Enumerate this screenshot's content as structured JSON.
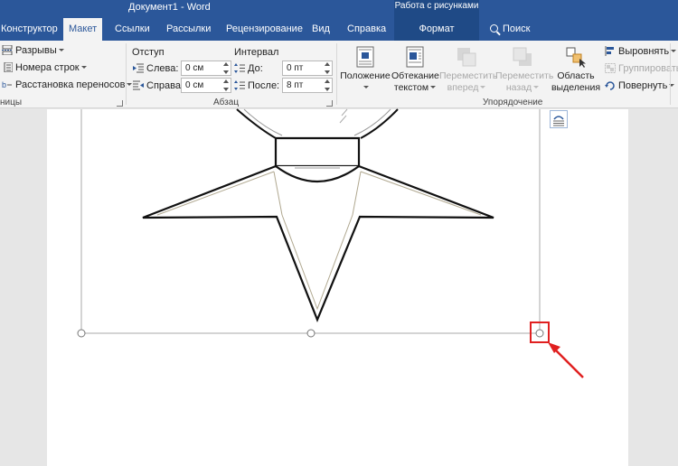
{
  "window": {
    "title": "Документ1 - Word",
    "context_group": "Работа с рисунками"
  },
  "tabs": [
    {
      "label": "Конструктор"
    },
    {
      "label": "Макет",
      "active": true
    },
    {
      "label": "Ссылки"
    },
    {
      "label": "Рассылки"
    },
    {
      "label": "Рецензирование"
    },
    {
      "label": "Вид"
    },
    {
      "label": "Справка"
    },
    {
      "label": "Формат",
      "contextual": true
    },
    {
      "label": "Поиск"
    }
  ],
  "ribbon": {
    "page_setup": {
      "breaks": "Разрывы",
      "line_numbers": "Номера строк",
      "hyphenation": "Расстановка переносов",
      "group_label": "ницы"
    },
    "paragraph": {
      "indent_header": "Отступ",
      "spacing_header": "Интервал",
      "left_label": "Слева:",
      "left_value": "0 см",
      "right_label": "Справа:",
      "right_value": "0 см",
      "before_label": "До:",
      "before_value": "0 пт",
      "after_label": "После:",
      "after_value": "8 пт",
      "group_label": "Абзац"
    },
    "arrange": {
      "position_label": "Положение",
      "wrap_label_1": "Обтекание",
      "wrap_label_2": "текстом",
      "forward_label_1": "Переместить",
      "forward_label_2": "вперед",
      "backward_label_1": "Переместить",
      "backward_label_2": "назад",
      "selection_label_1": "Область",
      "selection_label_2": "выделения",
      "align_label": "Выровнять",
      "group_btn_label": "Группировать",
      "rotate_label": "Повернуть",
      "group_label": "Упорядочение"
    }
  },
  "colors": {
    "title_bar": "#2b579a",
    "context_tab": "#1f4a86",
    "ribbon_bg": "#f3f3f3",
    "annotation": "#e02020"
  },
  "icons": [
    "search-icon",
    "breaks-icon",
    "line-numbers-icon",
    "hyphenation-icon",
    "indent-left-icon",
    "indent-right-icon",
    "spacing-before-icon",
    "spacing-after-icon",
    "position-icon",
    "wrap-text-icon",
    "bring-forward-icon",
    "send-backward-icon",
    "selection-pane-icon",
    "align-icon",
    "group-icon",
    "rotate-icon",
    "layout-options-icon",
    "resize-handle-icon"
  ]
}
